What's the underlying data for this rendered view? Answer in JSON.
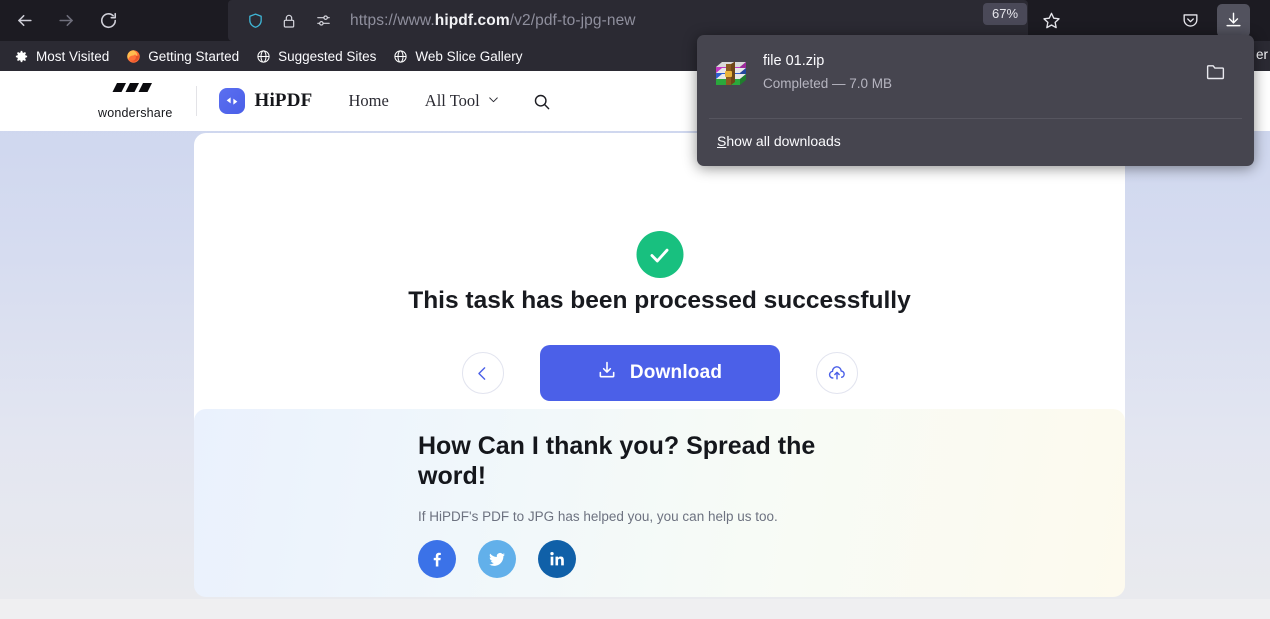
{
  "browser": {
    "url_prefix": "https://www.",
    "url_host": "hipdf.com",
    "url_suffix": "/v2/pdf-to-jpg-new",
    "zoom_level": "67%",
    "back_icon": "back-arrow-icon",
    "forward_icon": "forward-arrow-icon",
    "reload_icon": "reload-icon",
    "shield_icon": "shield-icon",
    "lock_icon": "lock-icon",
    "permissions_icon": "permissions-icon",
    "star_icon": "bookmark-star-icon",
    "pocket_icon": "pocket-icon",
    "downloads_icon": "downloads-arrow-icon"
  },
  "bookmarks": {
    "items": [
      {
        "label": "Most Visited",
        "icon": "gear-icon"
      },
      {
        "label": "Getting Started",
        "icon": "firefox-icon"
      },
      {
        "label": "Suggested Sites",
        "icon": "globe-icon"
      },
      {
        "label": "Web Slice Gallery",
        "icon": "globe-icon"
      }
    ],
    "clipped_label": "er"
  },
  "downloads_panel": {
    "file_name": "file 01.zip",
    "status": "Completed — 7.0 MB",
    "file_icon": "zip-archive-icon",
    "folder_icon": "open-folder-icon",
    "show_all_accesskey": "S",
    "show_all_rest": "how all downloads"
  },
  "site_header": {
    "brand": "wondershare",
    "brand_icon": "wondershare-diamonds-icon",
    "product": "HiPDF",
    "product_icon": "hipdf-logo-icon",
    "nav": [
      {
        "label": "Home"
      },
      {
        "label": "All Tool",
        "icon": "chevron-down-icon"
      }
    ],
    "search_icon": "search-icon"
  },
  "result_card": {
    "status_icon": "green-check-circle-icon",
    "title": "This task has been processed successfully",
    "back_icon": "chevron-left-icon",
    "download_label": "Download",
    "download_icon": "download-tray-icon",
    "cloud_icon": "cloud-upload-icon",
    "accent_color": "#4b60e8",
    "success_color": "#18c07f"
  },
  "promo_card": {
    "title": "How Can I thank you? Spread the word!",
    "subtitle": "If HiPDF's PDF to JPG has helped you, you can help us too.",
    "socials": [
      {
        "name": "facebook",
        "icon": "facebook-icon",
        "color": "#3b72e8"
      },
      {
        "name": "twitter",
        "icon": "twitter-icon",
        "color": "#62b0ea"
      },
      {
        "name": "linkedin",
        "icon": "linkedin-icon",
        "color": "#1060a8"
      }
    ]
  }
}
